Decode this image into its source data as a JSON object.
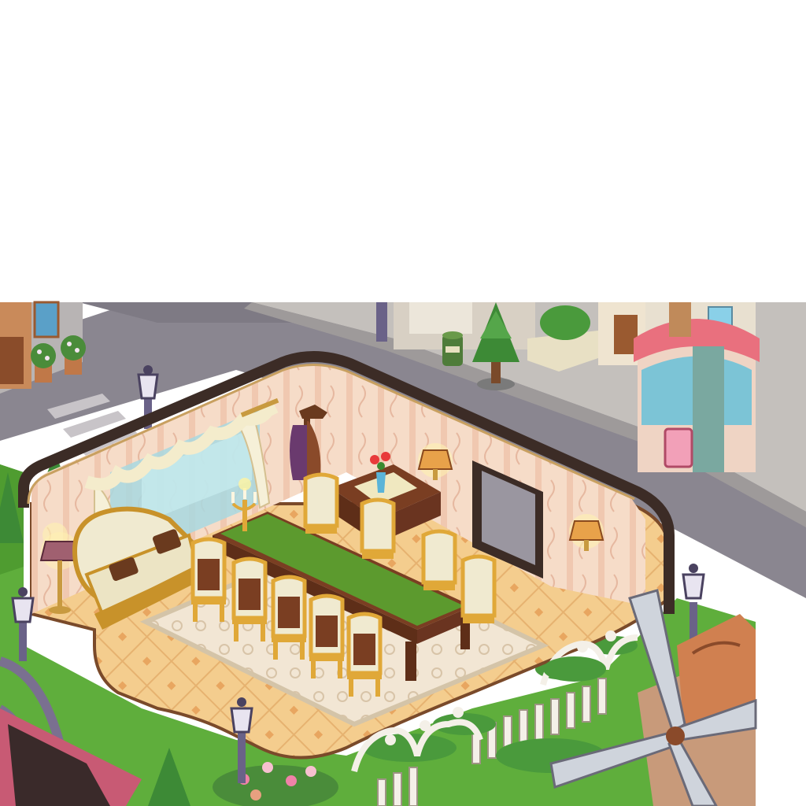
{
  "scene": {
    "kind": "isometric-room",
    "room": "dining room",
    "palette": {
      "road": "#8a8690",
      "sidewalk": "#b8b4b4",
      "grass": "#5fae3c",
      "floor_tile": "#f4cd8e",
      "wallpaper": "#f6dcc8",
      "wall_trim": "#3c2c26",
      "table_felt": "#5c9a2e",
      "wood": "#7a3e22",
      "gold": "#e0a838",
      "chair_cushion": "#f0ead0",
      "shop_awning": "#e9707e",
      "shop_teal": "#7cc4d6"
    },
    "icons": [
      "street-lamp-icon",
      "tree-icon",
      "flower-pot-icon",
      "trash-can-icon",
      "windmill-icon",
      "flower-vase-icon",
      "candelabra-icon",
      "wall-lamp-icon",
      "coat-rack-icon",
      "sofa-icon",
      "dining-chair-icon"
    ]
  }
}
